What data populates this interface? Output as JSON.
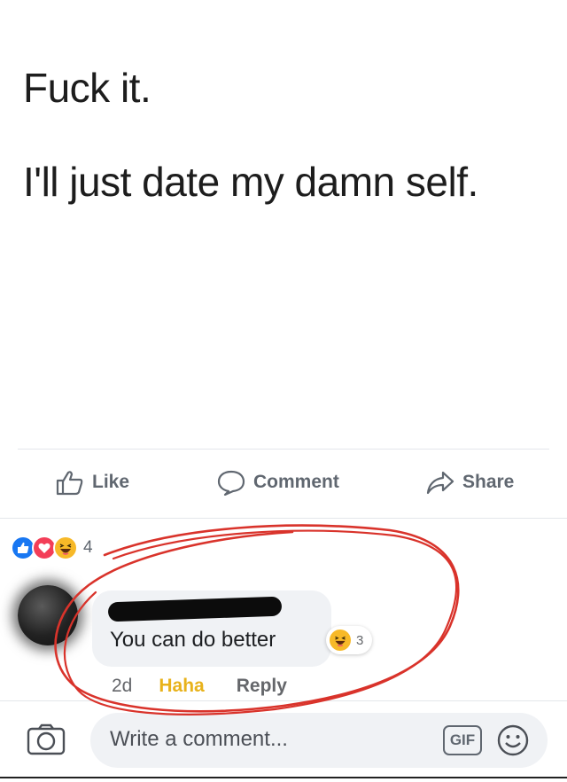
{
  "post": {
    "line1": "Fuck it.",
    "line2": "I'll just date my damn self."
  },
  "actions": {
    "like": "Like",
    "comment": "Comment",
    "share": "Share"
  },
  "reactions": {
    "types": [
      "like-icon",
      "love-icon",
      "haha-icon"
    ],
    "count": "4"
  },
  "comment": {
    "body": "You can do better",
    "reaction_icon": "haha-icon",
    "reaction_count": "3",
    "time": "2d",
    "haha_label": "Haha",
    "reply_label": "Reply"
  },
  "composer": {
    "placeholder": "Write a comment...",
    "gif_label": "GIF"
  },
  "colors": {
    "like_blue": "#1877f2",
    "love_red": "#f33e58",
    "haha_yellow": "#f7b928",
    "haha_text": "#e8b21b",
    "annotation_red": "#d9332b"
  }
}
